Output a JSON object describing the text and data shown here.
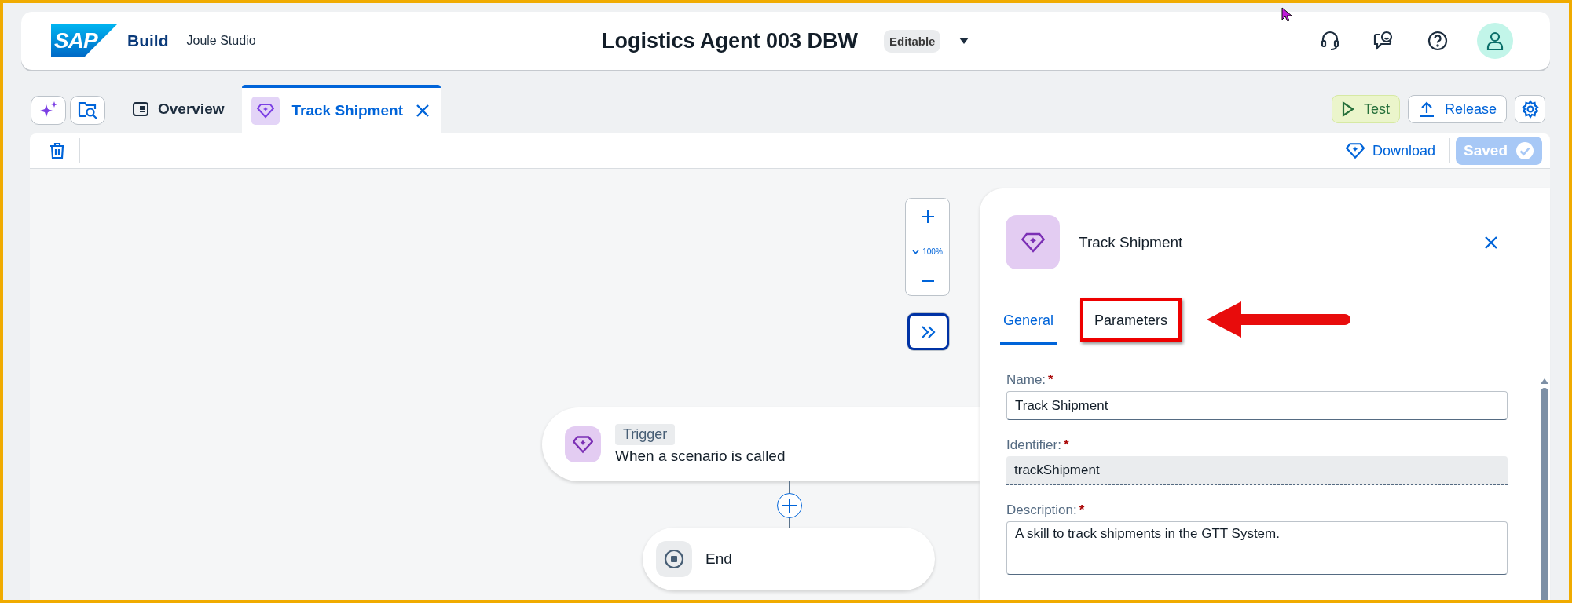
{
  "header": {
    "logo": "SAP",
    "product": "Build",
    "app": "Joule Studio",
    "title": "Logistics Agent 003 DBW",
    "status_badge": "Editable"
  },
  "editor_tabs": [
    {
      "kind": "overview",
      "label": "Overview",
      "selected": false,
      "closable": false
    },
    {
      "kind": "skill",
      "label": "Track Shipment",
      "selected": true,
      "closable": true
    }
  ],
  "actions": [
    {
      "kind": "test",
      "label": "Test"
    },
    {
      "kind": "release",
      "label": "Release"
    }
  ],
  "toolbar": {
    "download": "Download",
    "saved": "Saved"
  },
  "canvas": {
    "zoom": "100%",
    "trigger": {
      "tag": "Trigger",
      "text": "When a scenario is called"
    },
    "end": "End"
  },
  "panel": {
    "title": "Track Shipment",
    "tabs": [
      {
        "label": "General",
        "selected": true,
        "highlighted": false
      },
      {
        "label": "Parameters",
        "selected": false,
        "highlighted": true
      }
    ],
    "fields": [
      {
        "kind": "input",
        "label": "Name:",
        "required_mark": "*",
        "value": "Track Shipment"
      },
      {
        "kind": "readonly",
        "label": "Identifier:",
        "required_mark": "*",
        "value": "trackShipment"
      },
      {
        "kind": "textarea",
        "label": "Description:",
        "required_mark": "*",
        "value": "A skill to track shipments in the GTT System."
      }
    ]
  }
}
